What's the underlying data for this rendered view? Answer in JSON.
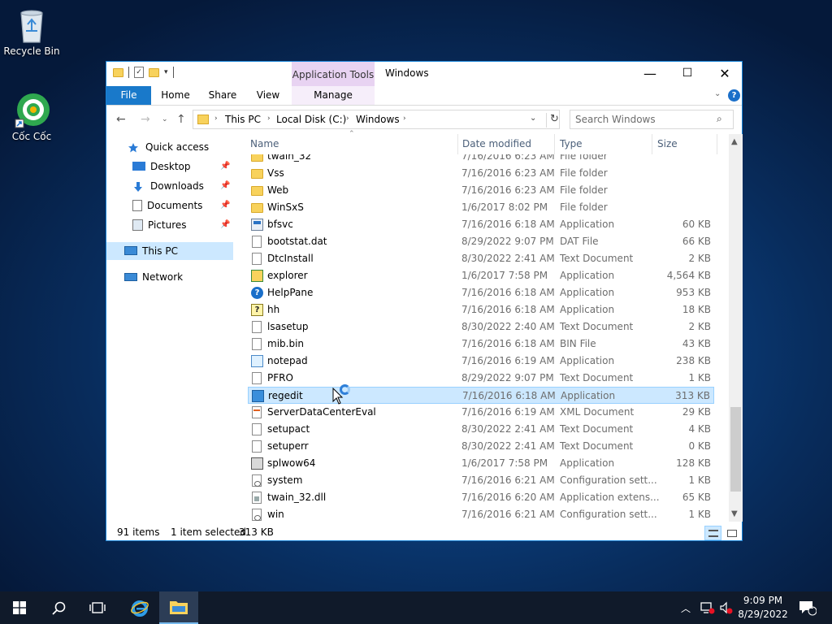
{
  "desktop": {
    "icons": [
      {
        "label": "Recycle Bin",
        "icon": "recycle-bin-icon"
      },
      {
        "label": "Cốc Cốc",
        "icon": "coccoc-browser-icon"
      }
    ]
  },
  "window": {
    "title": "Windows",
    "contextual_tab_group": "Application Tools",
    "tabs": [
      {
        "label": "File"
      },
      {
        "label": "Home"
      },
      {
        "label": "Share"
      },
      {
        "label": "View"
      },
      {
        "label": "Manage"
      }
    ],
    "controls": {
      "minimize": "—",
      "maximize": "☐",
      "close": "✕"
    }
  },
  "address": {
    "crumbs": [
      "This PC",
      "Local Disk (C:)",
      "Windows"
    ],
    "search_placeholder": "Search Windows"
  },
  "nav_pane": {
    "items": [
      {
        "label": "Quick access"
      },
      {
        "label": "Desktop"
      },
      {
        "label": "Downloads"
      },
      {
        "label": "Documents"
      },
      {
        "label": "Pictures"
      },
      {
        "label": "This PC"
      },
      {
        "label": "Network"
      }
    ]
  },
  "columns": {
    "name": "Name",
    "date": "Date modified",
    "type": "Type",
    "size": "Size"
  },
  "files": [
    {
      "name": "twain_32",
      "date": "7/16/2016 6:23 AM",
      "type": "File folder",
      "size": "",
      "icon": "folder"
    },
    {
      "name": "Vss",
      "date": "7/16/2016 6:23 AM",
      "type": "File folder",
      "size": "",
      "icon": "folder"
    },
    {
      "name": "Web",
      "date": "7/16/2016 6:23 AM",
      "type": "File folder",
      "size": "",
      "icon": "folder"
    },
    {
      "name": "WinSxS",
      "date": "1/6/2017 8:02 PM",
      "type": "File folder",
      "size": "",
      "icon": "folder"
    },
    {
      "name": "bfsvc",
      "date": "7/16/2016 6:18 AM",
      "type": "Application",
      "size": "60 KB",
      "icon": "app"
    },
    {
      "name": "bootstat.dat",
      "date": "8/29/2022 9:07 PM",
      "type": "DAT File",
      "size": "66 KB",
      "icon": "doc"
    },
    {
      "name": "DtcInstall",
      "date": "8/30/2022 2:41 AM",
      "type": "Text Document",
      "size": "2 KB",
      "icon": "doc"
    },
    {
      "name": "explorer",
      "date": "1/6/2017 7:58 PM",
      "type": "Application",
      "size": "4,564 KB",
      "icon": "exp"
    },
    {
      "name": "HelpPane",
      "date": "7/16/2016 6:18 AM",
      "type": "Application",
      "size": "953 KB",
      "icon": "help"
    },
    {
      "name": "hh",
      "date": "7/16/2016 6:18 AM",
      "type": "Application",
      "size": "18 KB",
      "icon": "hh"
    },
    {
      "name": "lsasetup",
      "date": "8/30/2022 2:40 AM",
      "type": "Text Document",
      "size": "2 KB",
      "icon": "doc"
    },
    {
      "name": "mib.bin",
      "date": "7/16/2016 6:18 AM",
      "type": "BIN File",
      "size": "43 KB",
      "icon": "doc"
    },
    {
      "name": "notepad",
      "date": "7/16/2016 6:19 AM",
      "type": "Application",
      "size": "238 KB",
      "icon": "note"
    },
    {
      "name": "PFRO",
      "date": "8/29/2022 9:07 PM",
      "type": "Text Document",
      "size": "1 KB",
      "icon": "doc"
    },
    {
      "name": "regedit",
      "date": "7/16/2016 6:18 AM",
      "type": "Application",
      "size": "313 KB",
      "icon": "reg",
      "selected": true
    },
    {
      "name": "ServerDataCenterEval",
      "date": "7/16/2016 6:19 AM",
      "type": "XML Document",
      "size": "29 KB",
      "icon": "xml"
    },
    {
      "name": "setupact",
      "date": "8/30/2022 2:41 AM",
      "type": "Text Document",
      "size": "4 KB",
      "icon": "doc"
    },
    {
      "name": "setuperr",
      "date": "8/30/2022 2:41 AM",
      "type": "Text Document",
      "size": "0 KB",
      "icon": "doc"
    },
    {
      "name": "splwow64",
      "date": "1/6/2017 7:58 PM",
      "type": "Application",
      "size": "128 KB",
      "icon": "print"
    },
    {
      "name": "system",
      "date": "7/16/2016 6:21 AM",
      "type": "Configuration sett...",
      "size": "1 KB",
      "icon": "cfg"
    },
    {
      "name": "twain_32.dll",
      "date": "7/16/2016 6:20 AM",
      "type": "Application extens...",
      "size": "65 KB",
      "icon": "dll"
    },
    {
      "name": "win",
      "date": "7/16/2016 6:21 AM",
      "type": "Configuration sett...",
      "size": "1 KB",
      "icon": "cfg"
    }
  ],
  "status": {
    "item_count": "91 items",
    "selection": "1 item selected",
    "selection_size": "313 KB"
  },
  "taskbar": {
    "time": "9:09 PM",
    "date": "8/29/2022",
    "notification_count": "1"
  },
  "colors": {
    "accent": "#1979ca",
    "selection": "#cce8ff",
    "contextual_tab": "#e8d3f2"
  }
}
